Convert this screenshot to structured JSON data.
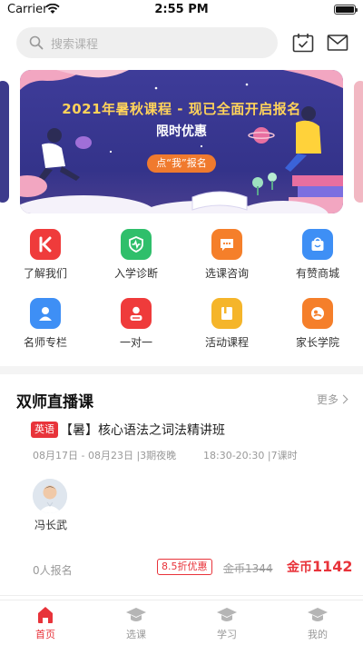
{
  "status_bar": {
    "carrier": "Carrier",
    "time": "2:55 PM"
  },
  "search": {
    "placeholder": "搜索课程"
  },
  "header_icons": {
    "calendar": "calendar-check-icon",
    "mail": "mail-icon"
  },
  "banner": {
    "title": "2021年暑秋课程 - 现已全面开启报名",
    "subtitle": "限时优惠",
    "button": "点“我”报名",
    "colors": {
      "background": "#3e3c99",
      "title": "#ffd35a",
      "button": "#f07a2e"
    }
  },
  "menu": [
    {
      "label": "了解我们",
      "icon": "k-logo-icon",
      "color": "#ef3b3b"
    },
    {
      "label": "入学诊断",
      "icon": "shield-pulse-icon",
      "color": "#2fbf6b"
    },
    {
      "label": "选课咨询",
      "icon": "chat-bubble-icon",
      "color": "#f57f2a"
    },
    {
      "label": "有赞商城",
      "icon": "shopping-bag-icon",
      "color": "#3e8ff5"
    },
    {
      "label": "名师专栏",
      "icon": "person-icon",
      "color": "#3e8ff5"
    },
    {
      "label": "一对一",
      "icon": "one-on-one-icon",
      "color": "#ef3b3b"
    },
    {
      "label": "活动课程",
      "icon": "book-icon",
      "color": "#f5b52a"
    },
    {
      "label": "家长学院",
      "icon": "parent-icon",
      "color": "#f57f2a"
    }
  ],
  "section": {
    "title": "双师直播课",
    "more": "更多"
  },
  "course": {
    "tag": "英语",
    "name": "【暑】核心语法之词法精讲班",
    "date": "08月17日 - 08月23日 |3期夜晚",
    "time": "18:30-20:30 |7课时",
    "teacher": "冯长武",
    "enrolled": "0人报名",
    "discount": "8.5折优惠",
    "original_price_label": "金币",
    "original_price": "1344",
    "price_label": "金币",
    "price": "1142"
  },
  "tabs": [
    {
      "label": "首页",
      "icon": "home-icon",
      "active": true
    },
    {
      "label": "选课",
      "icon": "graduation-cap-icon",
      "active": false
    },
    {
      "label": "学习",
      "icon": "graduation-cap-icon",
      "active": false
    },
    {
      "label": "我的",
      "icon": "graduation-cap-icon",
      "active": false
    }
  ],
  "colors": {
    "accent": "#e8333a",
    "muted": "#999999"
  }
}
